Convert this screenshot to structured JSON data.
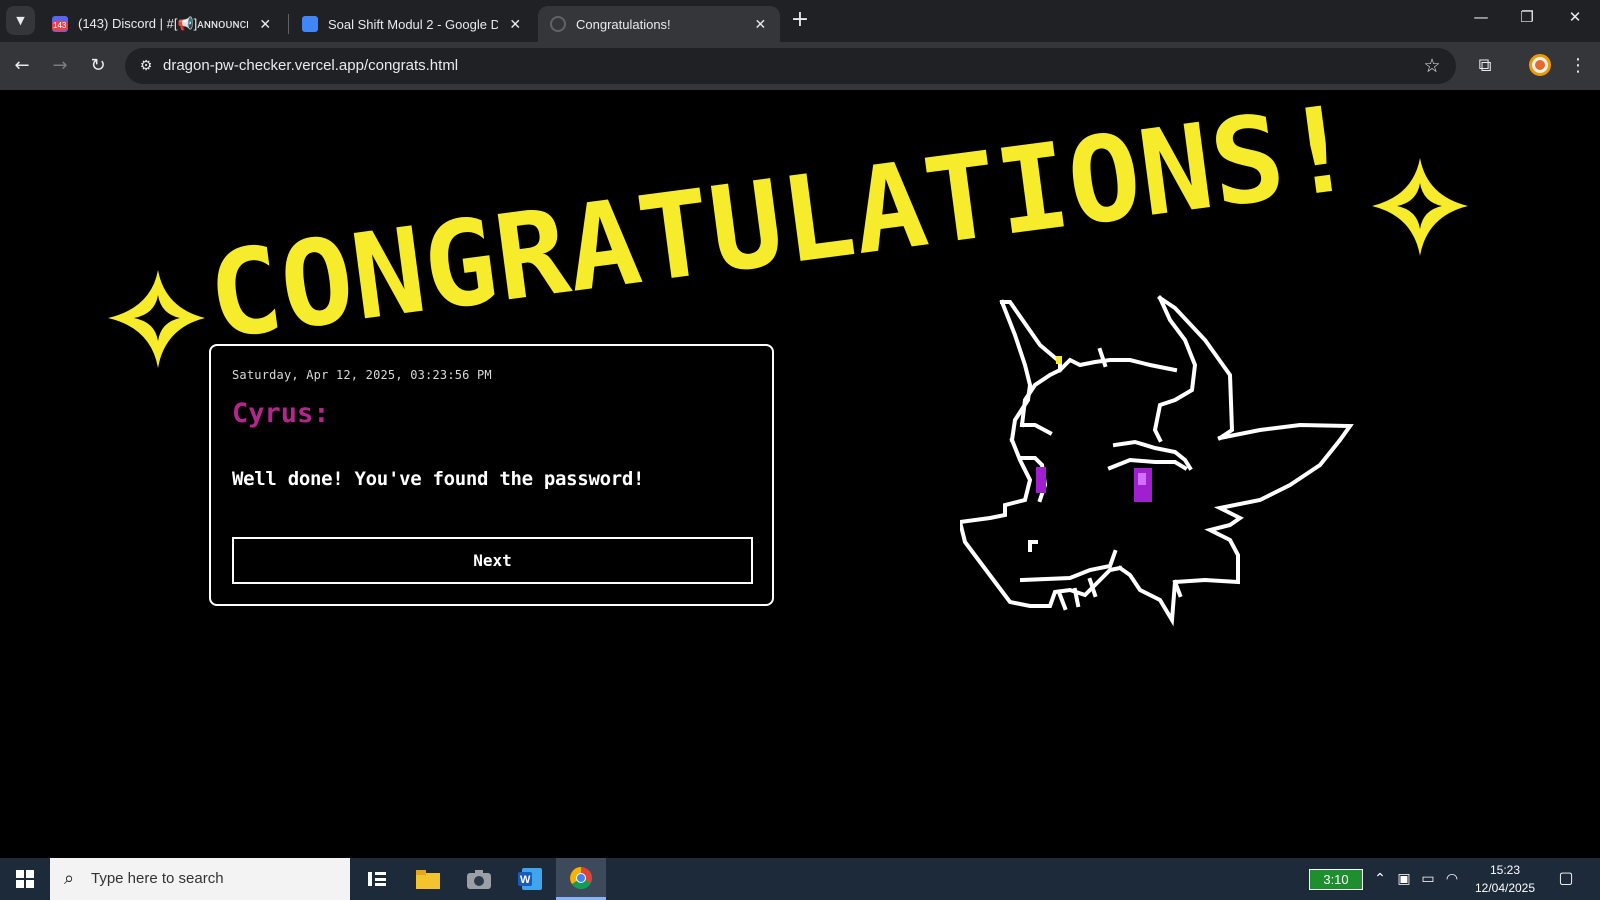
{
  "browser": {
    "tabs": [
      {
        "title": "(143) Discord | #[📢]ᴀɴɴᴏᴜɴᴄᴇ",
        "badge": "143",
        "active": false
      },
      {
        "title": "Soal Shift Modul 2 - Google Do",
        "active": false
      },
      {
        "title": "Congratulations!",
        "active": true
      }
    ],
    "url": "dragon-pw-checker.vercel.app/congrats.html"
  },
  "page": {
    "headline": "CONGRATULATIONS!",
    "headline_color": "#f6ec2c",
    "dialog": {
      "timestamp": "Saturday, Apr 12, 2025, 03:23:56 PM",
      "speaker": "Cyrus:",
      "speaker_color": "#b5258e",
      "message": "Well done! You've found the password!",
      "next_label": "Next"
    }
  },
  "taskbar": {
    "search_placeholder": "Type here to search",
    "battery_time": "3:10",
    "time": "15:23",
    "date": "12/04/2025"
  }
}
